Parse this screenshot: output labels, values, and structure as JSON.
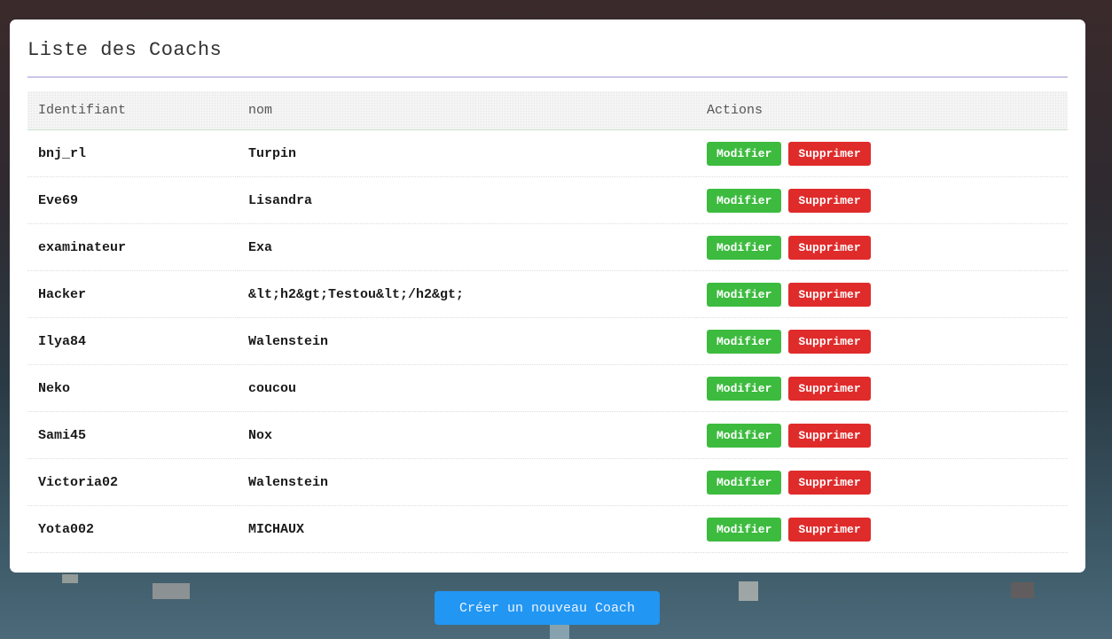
{
  "page": {
    "title": "Liste des Coachs"
  },
  "table": {
    "headers": {
      "id": "Identifiant",
      "nom": "nom",
      "actions": "Actions"
    },
    "rows": [
      {
        "id": "bnj_rl",
        "nom": "Turpin"
      },
      {
        "id": "Eve69",
        "nom": "Lisandra"
      },
      {
        "id": "examinateur",
        "nom": "Exa"
      },
      {
        "id": "Hacker",
        "nom": "&lt;h2&gt;Testou&lt;/h2&gt;"
      },
      {
        "id": "Ilya84",
        "nom": "Walenstein"
      },
      {
        "id": "Neko",
        "nom": "coucou"
      },
      {
        "id": "Sami45",
        "nom": "Nox"
      },
      {
        "id": "Victoria02",
        "nom": "Walenstein"
      },
      {
        "id": "Yota002",
        "nom": "MICHAUX"
      }
    ],
    "actions": {
      "edit_label": "Modifier",
      "delete_label": "Supprimer"
    }
  },
  "footer": {
    "create_label": "Créer un nouveau Coach"
  },
  "colors": {
    "edit": "#3dbb3f",
    "delete": "#e02b2b",
    "primary": "#2196f3"
  }
}
